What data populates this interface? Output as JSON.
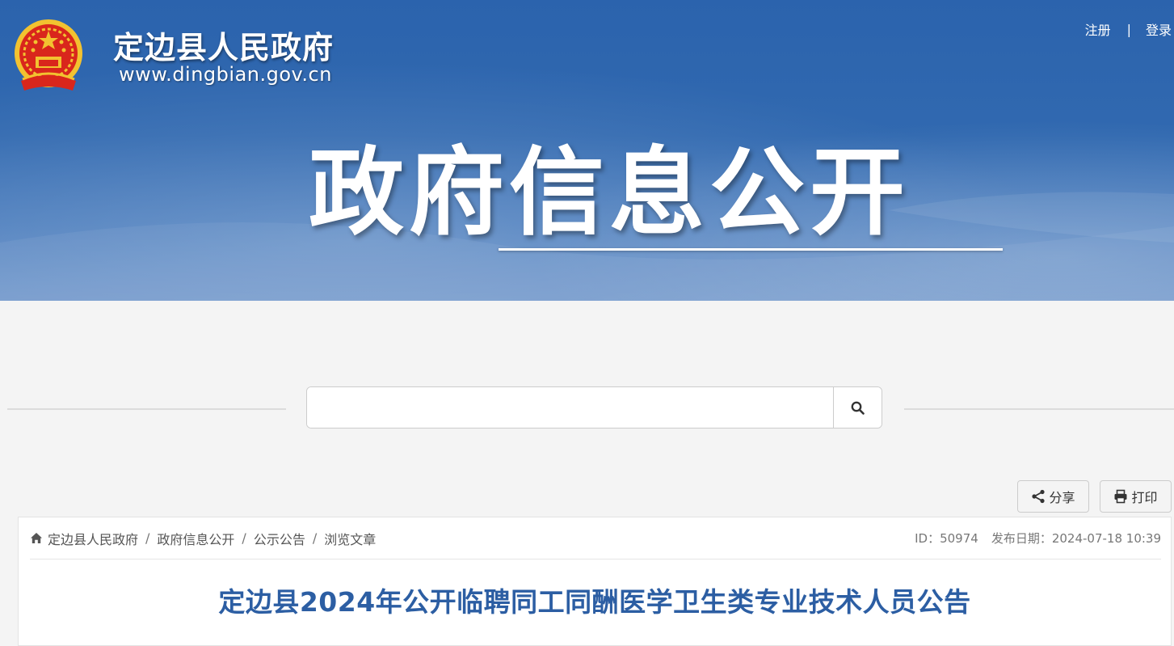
{
  "header": {
    "site_name": "定边县人民政府",
    "site_url": "www.dingbian.gov.cn",
    "register_label": "注册",
    "separator": "|",
    "login_label": "登录",
    "banner_title": "政府信息公开"
  },
  "search": {
    "placeholder": "",
    "icon": "search-icon"
  },
  "toolbar": {
    "share_label": "分享",
    "share_icon": "share-icon",
    "print_label": "打印",
    "print_icon": "print-icon"
  },
  "breadcrumb": {
    "home_icon": "home-icon",
    "items": [
      "定边县人民政府",
      "政府信息公开",
      "公示公告",
      "浏览文章"
    ],
    "separator": "/"
  },
  "meta": {
    "id_text": "ID：50974",
    "date_text": "发布日期：2024-07-18 10:39"
  },
  "article": {
    "title": "定边县2024年公开临聘同工同酬医学卫生类专业技术人员公告"
  },
  "colors": {
    "banner_blue": "#2b63ad",
    "title_blue": "#2c5ea3",
    "page_bg": "#f4f4f4"
  }
}
